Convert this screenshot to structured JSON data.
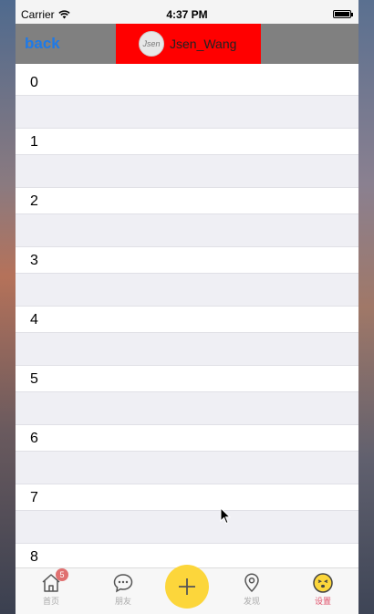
{
  "status_bar": {
    "carrier": "Carrier",
    "time": "4:37 PM"
  },
  "nav": {
    "back_label": "back",
    "title": "Jsen_Wang",
    "avatar_text": "Jsen"
  },
  "rows": [
    "0",
    "1",
    "2",
    "3",
    "4",
    "5",
    "6",
    "7",
    "8"
  ],
  "tabs": [
    {
      "label": "首页",
      "icon": "home-icon",
      "badge": "5"
    },
    {
      "label": "朋友",
      "icon": "chat-bubble-icon"
    },
    {
      "label": "发现",
      "icon": "location-pin-icon"
    },
    {
      "label": "设置",
      "icon": "face-emoji-icon"
    }
  ],
  "colors": {
    "accent": "#1e7ae8",
    "title_bg": "#ff0000",
    "plus": "#fcd63b",
    "active_tab": "#e0506a"
  }
}
